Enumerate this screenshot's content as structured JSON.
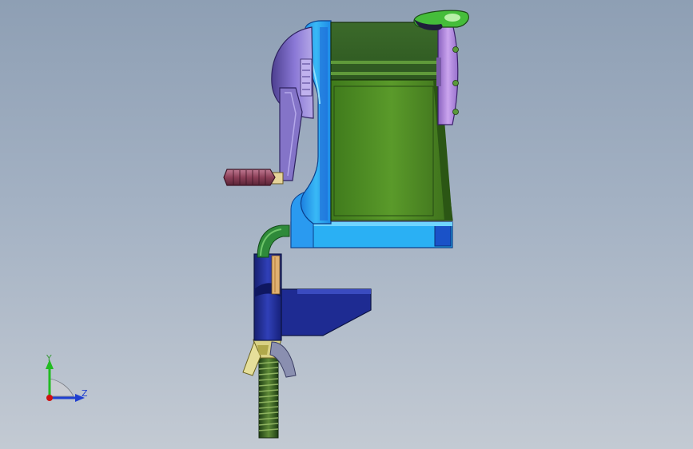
{
  "viewport": {
    "background_top": "#8e9fb4",
    "background_bottom": "#c3cad3"
  },
  "model": {
    "subject": "pencil-sharpener-assembly",
    "part_colors": {
      "body": "#2aa7f0",
      "body_dark": "#1f6fd6",
      "housing": "#3f6a28",
      "housing_face": "#4f8a24",
      "crank_dome": "#7b66c2",
      "crank_arm": "#8274c8",
      "knob": "#9a4a64",
      "dial": "#b58ad8",
      "selector": "#43b83a",
      "neck": "#2f8a3a",
      "clamp": "#1f2a8c",
      "wing_nut": "#d8cf7a",
      "screw": "#2e5a1e"
    }
  },
  "triad": {
    "y_label": "Y",
    "z_label": "Z",
    "y_color": "#22bb22",
    "z_color": "#1f3fd0",
    "x_color": "#d01010"
  }
}
